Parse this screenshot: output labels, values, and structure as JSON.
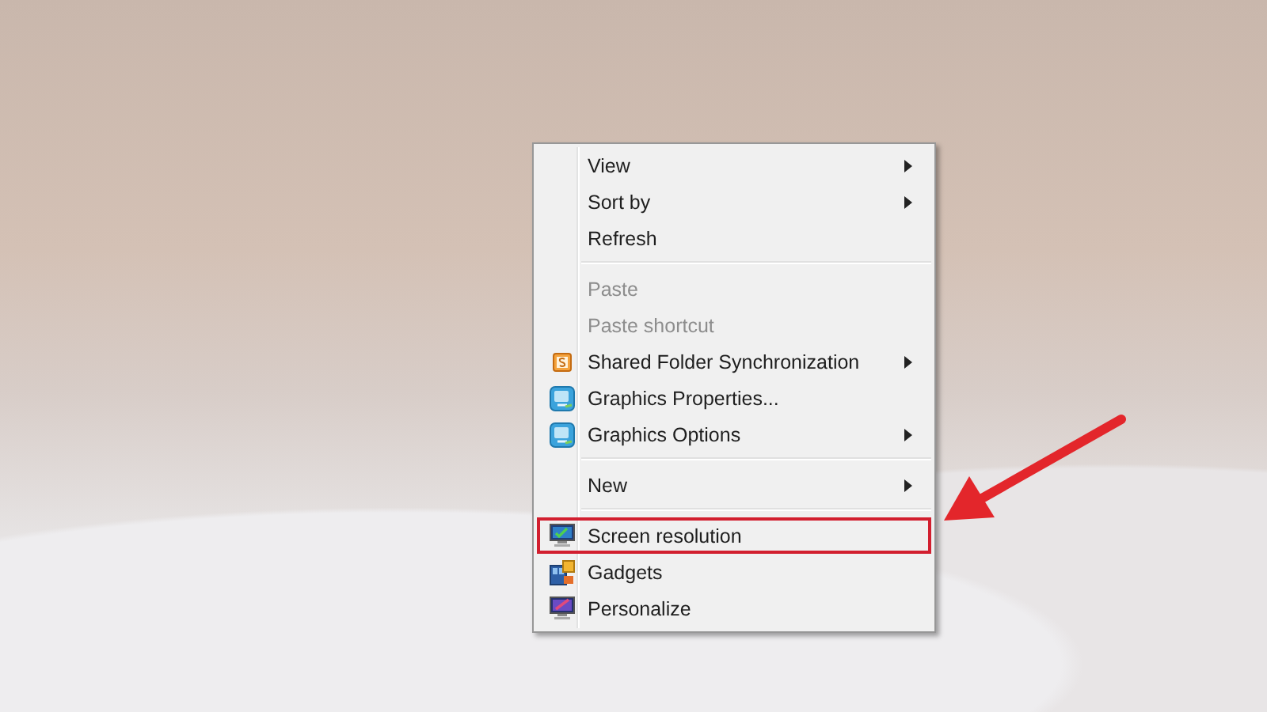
{
  "context_menu": {
    "items": [
      {
        "kind": "item",
        "label": "View",
        "disabled": false,
        "submenu": true,
        "highlighted": false
      },
      {
        "kind": "item",
        "label": "Sort by",
        "disabled": false,
        "submenu": true,
        "highlighted": false
      },
      {
        "kind": "item",
        "label": "Refresh",
        "disabled": false,
        "submenu": false,
        "highlighted": false
      },
      {
        "kind": "separator"
      },
      {
        "kind": "item",
        "label": "Paste",
        "disabled": true,
        "submenu": false,
        "highlighted": false
      },
      {
        "kind": "item",
        "label": "Paste shortcut",
        "disabled": true,
        "submenu": false,
        "highlighted": false
      },
      {
        "kind": "item",
        "label": "Shared Folder Synchronization",
        "disabled": false,
        "submenu": true,
        "highlighted": false
      },
      {
        "kind": "item",
        "label": "Graphics Properties...",
        "disabled": false,
        "submenu": false,
        "highlighted": false
      },
      {
        "kind": "item",
        "label": "Graphics Options",
        "disabled": false,
        "submenu": true,
        "highlighted": false
      },
      {
        "kind": "separator"
      },
      {
        "kind": "item",
        "label": "New",
        "disabled": false,
        "submenu": true,
        "highlighted": false
      },
      {
        "kind": "separator"
      },
      {
        "kind": "item",
        "label": "Screen resolution",
        "disabled": false,
        "submenu": false,
        "highlighted": true
      },
      {
        "kind": "item",
        "label": "Gadgets",
        "disabled": false,
        "submenu": false,
        "highlighted": false
      },
      {
        "kind": "item",
        "label": "Personalize",
        "disabled": false,
        "submenu": false,
        "highlighted": false
      }
    ]
  }
}
